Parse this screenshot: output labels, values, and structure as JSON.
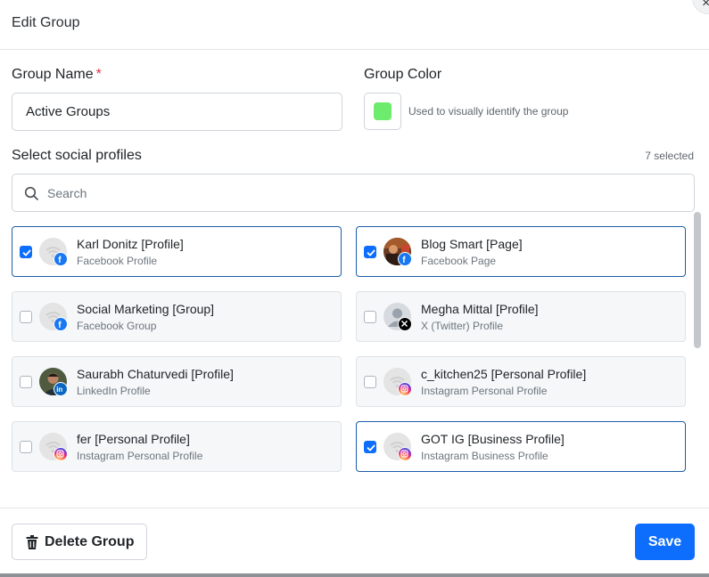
{
  "header": {
    "title": "Edit Group",
    "close_glyph": "×"
  },
  "form": {
    "group_name_label": "Group Name",
    "required_mark": "*",
    "group_name_value": "Active Groups",
    "group_color_label": "Group Color",
    "group_color_value": "#6ceb6c",
    "group_color_hint": "Used to visually identify the group",
    "profiles_label": "Select social profiles",
    "selected_count": "7 selected",
    "search_placeholder": "Search"
  },
  "profiles": [
    {
      "name": "Karl Donitz [Profile]",
      "type": "Facebook Profile",
      "network": "facebook",
      "avatar": "placeholder",
      "checked": true
    },
    {
      "name": "Blog Smart [Page]",
      "type": "Facebook Page",
      "network": "facebook",
      "avatar": "photo",
      "checked": true
    },
    {
      "name": "Social Marketing [Group]",
      "type": "Facebook Group",
      "network": "facebook",
      "avatar": "placeholder",
      "checked": false
    },
    {
      "name": "Megha Mittal [Profile]",
      "type": "X (Twitter) Profile",
      "network": "x",
      "avatar": "person",
      "checked": false
    },
    {
      "name": "Saurabh Chaturvedi [Profile]",
      "type": "LinkedIn Profile",
      "network": "linkedin",
      "avatar": "photo",
      "checked": false
    },
    {
      "name": "c_kitchen25 [Personal Profile]",
      "type": "Instagram Personal Profile",
      "network": "instagram",
      "avatar": "placeholder",
      "checked": false
    },
    {
      "name": "fer [Personal Profile]",
      "type": "Instagram Personal Profile",
      "network": "instagram",
      "avatar": "placeholder",
      "checked": false
    },
    {
      "name": "GOT IG [Business Profile]",
      "type": "Instagram Business Profile",
      "network": "instagram",
      "avatar": "placeholder",
      "checked": true
    }
  ],
  "footer": {
    "delete_label": "Delete Group",
    "save_label": "Save"
  },
  "colors": {
    "accent": "#0d6efd",
    "selected_border": "#1d5da8",
    "required": "#dc3545"
  }
}
